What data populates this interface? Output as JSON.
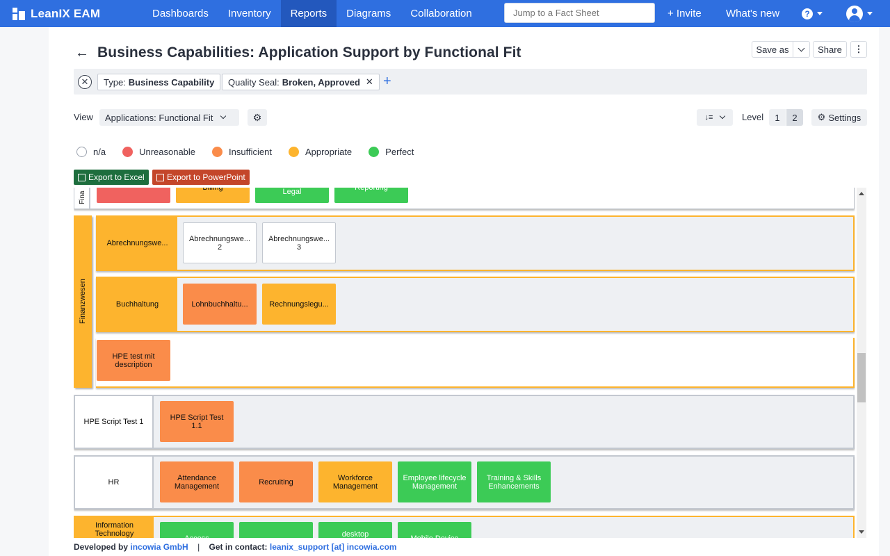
{
  "brand": {
    "name": "LeanIX EAM"
  },
  "nav": {
    "items": [
      {
        "label": "Dashboards"
      },
      {
        "label": "Inventory"
      },
      {
        "label": "Reports"
      },
      {
        "label": "Diagrams"
      },
      {
        "label": "Collaboration"
      }
    ],
    "search_placeholder": "Jump to a Fact Sheet",
    "invite": "+ Invite",
    "whats_new": "What's new",
    "help": "?"
  },
  "header": {
    "title": "Business Capabilities: Application Support by Functional Fit",
    "save_as": "Save as",
    "share": "Share",
    "more": "⋮"
  },
  "filters": {
    "clear": "✕",
    "chips": [
      {
        "key": "Type:",
        "value": "Business Capability",
        "removable": false
      },
      {
        "key": "Quality Seal:",
        "value": "Broken, Approved",
        "removable": true,
        "remove": "✕"
      }
    ],
    "add": "+"
  },
  "view": {
    "label": "View",
    "selected": "Applications: Functional Fit",
    "gear": "⚙",
    "sort": "↓≡",
    "level_label": "Level",
    "levels": [
      "1",
      "2"
    ],
    "settings": "Settings",
    "settings_icon": "⚙"
  },
  "legend": [
    {
      "label": "n/a",
      "color": "#ffffff"
    },
    {
      "label": "Unreasonable",
      "color": "#f0625f"
    },
    {
      "label": "Insufficient",
      "color": "#fa8c4a"
    },
    {
      "label": "Appropriate",
      "color": "#fdb42e"
    },
    {
      "label": "Perfect",
      "color": "#3ccb56"
    }
  ],
  "exports": {
    "excel": "Export to Excel",
    "powerpoint": "Export to PowerPoint"
  },
  "colors": {
    "accent": "#2f6fe0",
    "excel": "#1e6e3e",
    "powerpoint": "#c4462a",
    "orange_frame": "#fdb42e"
  },
  "map": {
    "top_partial": {
      "label": "Fina",
      "boxes": [
        {
          "label": "",
          "fit": "red"
        },
        {
          "label": "Billing",
          "fit": "yellow"
        },
        {
          "label": "Legal",
          "fit": "green"
        },
        {
          "label": "Reporting",
          "fit": "green"
        }
      ]
    },
    "finanzwesen": {
      "label": "Finanzwesen",
      "rows": [
        {
          "label": "Abrechnungswe...",
          "boxes": [
            {
              "label": "Abrechnungswe...",
              "sub": "2",
              "fit": "white"
            },
            {
              "label": "Abrechnungswe...",
              "sub": "3",
              "fit": "white"
            }
          ]
        },
        {
          "label": "Buchhaltung",
          "boxes": [
            {
              "label": "Lohnbuchhaltu...",
              "fit": "orange"
            },
            {
              "label": "Rechnungslegu...",
              "fit": "yellow"
            }
          ]
        }
      ],
      "standalone": {
        "label": "HPE test mit description",
        "fit": "orange"
      }
    },
    "hpe_script": {
      "label": "HPE Script Test 1",
      "boxes": [
        {
          "label": "HPE Script Test 1.1",
          "fit": "orange"
        }
      ]
    },
    "hr": {
      "label": "HR",
      "boxes": [
        {
          "label": "Attendance Management",
          "fit": "orange"
        },
        {
          "label": "Recruiting",
          "fit": "orange"
        },
        {
          "label": "Workforce Management",
          "fit": "yellow"
        },
        {
          "label": "Employee lifecycle Management",
          "fit": "green"
        },
        {
          "label": "Training & Skills Enhancements",
          "fit": "green"
        }
      ]
    },
    "it": {
      "label": "Information Technology",
      "boxes": [
        {
          "label": "Access",
          "fit": "green"
        },
        {
          "label": "",
          "fit": "green"
        },
        {
          "label": "desktop",
          "fit": "green"
        },
        {
          "label": "Mobile Device",
          "fit": "green"
        }
      ]
    }
  },
  "footer": {
    "developed_by": "Developed by",
    "company": "incowia GmbH",
    "separator": "|",
    "contact_label": "Get in contact:",
    "contact": "leanix_support [at] incowia.com"
  }
}
